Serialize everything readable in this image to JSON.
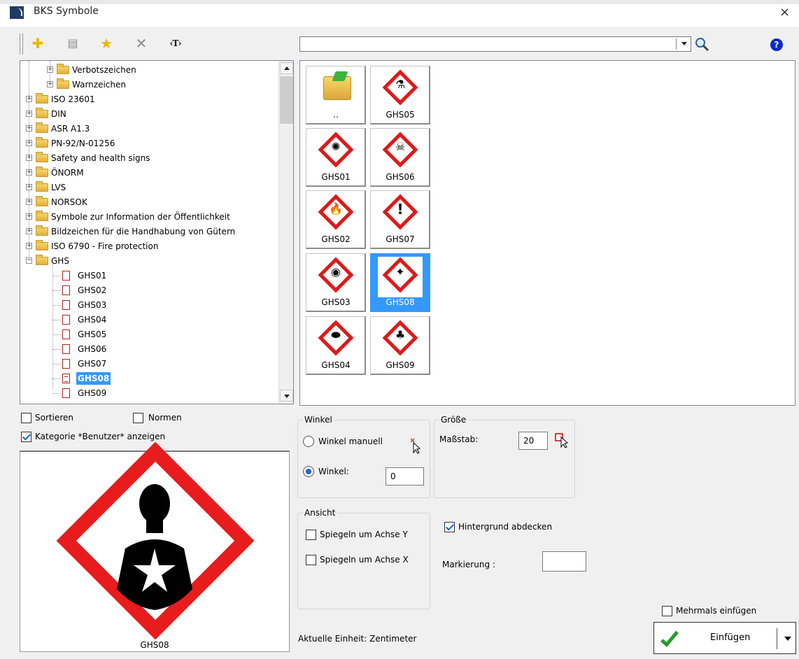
{
  "window": {
    "title": "BKS Symbole",
    "close_glyph": "×"
  },
  "toolbar": {
    "buttons": [
      {
        "name": "add-icon",
        "glyph": "✚",
        "color": "#f0c400"
      },
      {
        "name": "properties-icon",
        "glyph": "▤",
        "color": "#888888"
      },
      {
        "name": "favorite-star-icon",
        "glyph": "★",
        "color": "#f0b000"
      },
      {
        "name": "delete-icon",
        "glyph": "✕",
        "color": "#888888"
      },
      {
        "name": "text-tag-icon",
        "glyph": "‹T›",
        "color": "#000000"
      }
    ],
    "search_value": "",
    "help_glyph": "?"
  },
  "tree": {
    "items": [
      {
        "label": "Verbotszeichen"
      },
      {
        "label": "Warnzeichen"
      },
      {
        "label": "ISO 23601"
      },
      {
        "label": "DIN"
      },
      {
        "label": "ASR A1.3"
      },
      {
        "label": "PN-92/N-01256"
      },
      {
        "label": "Safety and health signs"
      },
      {
        "label": "ÖNORM"
      },
      {
        "label": "LVS"
      },
      {
        "label": "NORSOK"
      },
      {
        "label": "Symbole zur Information der Öffentlichkeit"
      },
      {
        "label": "Bildzeichen für die Handhabung von Gütern"
      },
      {
        "label": "ISO 6790 - Fire protection"
      },
      {
        "label": "GHS"
      },
      {
        "label": "GHS01"
      },
      {
        "label": "GHS02"
      },
      {
        "label": "GHS03"
      },
      {
        "label": "GHS04"
      },
      {
        "label": "GHS05"
      },
      {
        "label": "GHS06"
      },
      {
        "label": "GHS07"
      },
      {
        "label": "GHS08"
      },
      {
        "label": "GHS09"
      }
    ]
  },
  "grid": {
    "tiles": [
      {
        "label": "..",
        "glyph": ""
      },
      {
        "label": "GHS05",
        "glyph": "⚗"
      },
      {
        "label": "GHS01",
        "glyph": "✺"
      },
      {
        "label": "GHS06",
        "glyph": "☠"
      },
      {
        "label": "GHS02",
        "glyph": "🔥"
      },
      {
        "label": "GHS07",
        "glyph": "!"
      },
      {
        "label": "GHS03",
        "glyph": "◉"
      },
      {
        "label": "GHS08",
        "glyph": "✦"
      },
      {
        "label": "GHS04",
        "glyph": "⬬"
      },
      {
        "label": "GHS09",
        "glyph": "♣"
      }
    ]
  },
  "options": {
    "sortieren": "Sortieren",
    "normen": "Normen",
    "kategorie": "Kategorie *Benutzer* anzeigen"
  },
  "preview": {
    "caption": "GHS08"
  },
  "winkel": {
    "title": "Winkel",
    "manual_label": "Winkel manuell",
    "angle_label": "Winkel:",
    "angle_value": "0"
  },
  "groesse": {
    "title": "Größe",
    "scale_label": "Maßstab:",
    "scale_value": "20"
  },
  "ansicht": {
    "title": "Ansicht",
    "mirror_y": "Spiegeln um Achse Y",
    "mirror_x": "Spiegeln um Achse X"
  },
  "misc": {
    "background_cover": "Hintergrund abdecken",
    "marking_label": "Markierung :",
    "marking_value": "",
    "current_unit": "Aktuelle Einheit: Zentimeter",
    "insert_multiple": "Mehrmals einfügen",
    "insert_button": "Einfügen"
  },
  "colors": {
    "selection": "#3399ff",
    "hazard_red": "#e01818",
    "accent_check": "#1060d8"
  }
}
